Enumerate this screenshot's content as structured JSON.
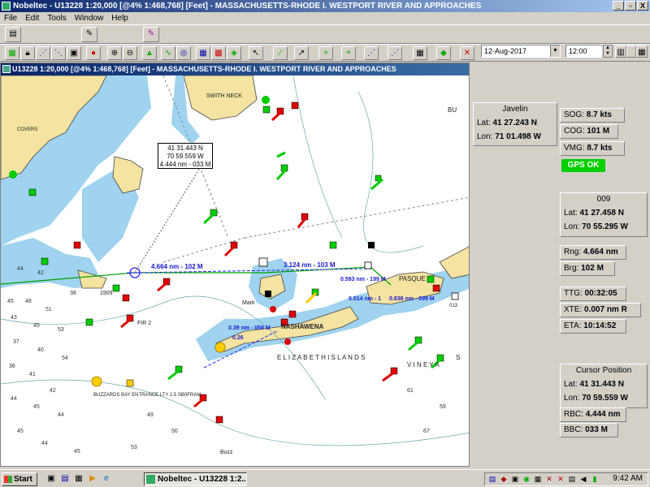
{
  "window": {
    "title": "Nobeltec - U13228 1:20,000 [@4% 1:468,768] [Feet] - MASSACHUSETTS-RHODE I. WESTPORT RIVER AND APPROACHES",
    "min": "_",
    "max": "▫",
    "close": "X"
  },
  "menu": [
    "File",
    "Edit",
    "Tools",
    "Window",
    "Help"
  ],
  "toolbar": {
    "date": "12-Aug-2017",
    "time": "12:00"
  },
  "chart": {
    "title": "U13228 1:20,000 [@4% 1:468,768] [Feet] - MASSACHUSETTS-RHODE I. WESTPORT RIVER AND APPROACHES",
    "popup": [
      "41 31.443 N",
      "70 59.559 W",
      "4.444 nm - 033 M"
    ],
    "labels": {
      "switch_neck": "SWITH NECK",
      "bu": "BU",
      "covers": "COVERS",
      "nashawena": "NASHAWENA",
      "elizabeth": "E L I Z A B E T H   I S L A N D S",
      "vineyard": "V I N E Y A",
      "s": "S",
      "pasque": "PASQUE",
      "mark": "Mark",
      "buzzards": "BUZZARDS BAY ENTRANCE LTY 2.5 SB0FRAM",
      "leg1": "4.664 nm - 102 M",
      "leg2": "3.124 nm - 103 M",
      "leg3": "0.593 nm - 199 M",
      "leg4": "0.514 nm - 1",
      "leg5": "0.838 nm - 099 M",
      "leg6": "0.39 nm - 058 M",
      "leg7": "0.26",
      "n1909": "1909",
      "fir2": "FIR 2",
      "n013": "013",
      "buz": "Buzz"
    }
  },
  "javelin": {
    "title": "Javelin",
    "lat_label": "Lat:",
    "lat": "41 27.243 N",
    "lon_label": "Lon:",
    "lon": "71 01.498 W"
  },
  "nav": {
    "sog_label": "SOG:",
    "sog": "8.7 kts",
    "cog_label": "COG:",
    "cog": "101 M",
    "vmg_label": "VMG:",
    "vmg": "8.7 kts",
    "gps_status": "GPS OK"
  },
  "waypoint": {
    "title": "009",
    "lat_label": "Lat:",
    "lat": "41 27.458 N",
    "lon_label": "Lon:",
    "lon": "70 55.295 W",
    "rng_label": "Rng:",
    "rng": "4.664 nm",
    "brg_label": "Brg:",
    "brg": "102 M",
    "ttg_label": "TTG:",
    "ttg": "00:32:05",
    "xte_label": "XTE:",
    "xte": "0.007 nm R",
    "eta_label": "ETA:",
    "eta": "10:14:52"
  },
  "cursor": {
    "title": "Cursor Position",
    "lat_label": "Lat:",
    "lat": "41 31.443 N",
    "lon_label": "Lon:",
    "lon": "70 59.559 W",
    "rbc_label": "RBC:",
    "rbc": "4.444 nm",
    "bbc_label": "BBC:",
    "bbc": "033 M"
  },
  "taskbar": {
    "start": "Start",
    "task": "Nobeltec - U13228 1:2...",
    "clock": "9:42 AM"
  },
  "colors": {
    "land": "#f4e3a1",
    "shallow": "#9fd3ef",
    "water": "#ffffff",
    "route": "#2a2aff",
    "track": "#00a000"
  }
}
